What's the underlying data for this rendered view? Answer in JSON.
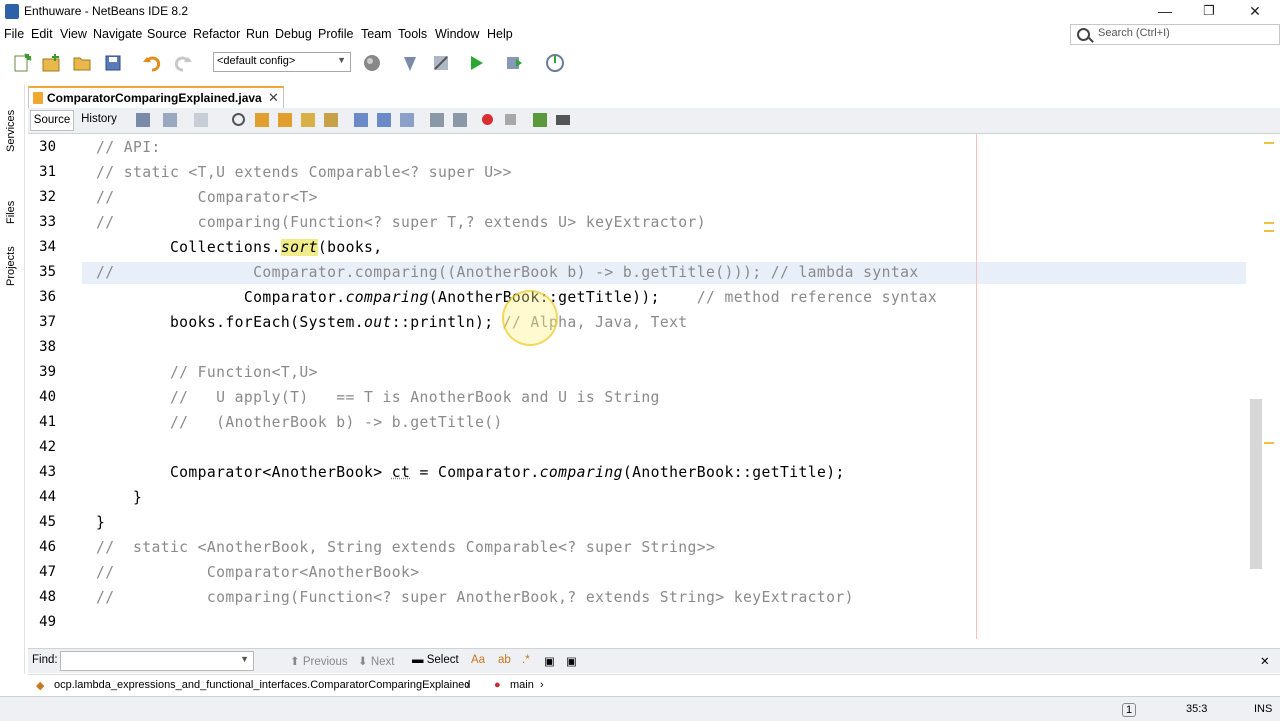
{
  "window": {
    "title": "Enthuware - NetBeans IDE 8.2",
    "minimize": "—",
    "maximize": "❐",
    "close": "✕"
  },
  "menu": [
    "File",
    "Edit",
    "View",
    "Navigate",
    "Source",
    "Refactor",
    "Run",
    "Debug",
    "Profile",
    "Team",
    "Tools",
    "Window",
    "Help"
  ],
  "search": {
    "placeholder": "Search (Ctrl+I)"
  },
  "toolbar": {
    "config": "<default config>"
  },
  "sidebar": {
    "items": [
      "Services",
      "Files",
      "Projects"
    ]
  },
  "editor_tab": {
    "label": "ComparatorComparingExplained.java",
    "close": "✕"
  },
  "editor_toolbar": {
    "source": "Source",
    "history": "History"
  },
  "code": {
    "lines": [
      {
        "n": "30",
        "text": "// API:",
        "indent": 0,
        "style": "cm"
      },
      {
        "n": "31",
        "text": "// static <T,U extends Comparable<? super U>>",
        "indent": 0,
        "style": "cm"
      },
      {
        "n": "32",
        "text": "//         Comparator<T>",
        "indent": 0,
        "style": "cm"
      },
      {
        "n": "33",
        "text": "//         comparing(Function<? super T,? extends U> keyExtractor)",
        "indent": 0,
        "style": "cm"
      },
      {
        "n": "34",
        "text": "",
        "indent": 0,
        "style": "code"
      },
      {
        "n": "35",
        "text": "//               Comparator.comparing((AnotherBook b) -> b.getTitle())); // lambda syntax",
        "indent": 0,
        "style": "cm"
      },
      {
        "n": "36",
        "text": "",
        "indent": 0,
        "style": "code"
      },
      {
        "n": "37",
        "text": "",
        "indent": 0,
        "style": "code"
      },
      {
        "n": "38",
        "text": "",
        "indent": 0,
        "style": "code"
      },
      {
        "n": "39",
        "text": "        // Function<T,U>",
        "indent": 0,
        "style": "cm"
      },
      {
        "n": "40",
        "text": "        //   U apply(T)   == T is AnotherBook and U is String",
        "indent": 0,
        "style": "cm"
      },
      {
        "n": "41",
        "text": "        //   (AnotherBook b) -> b.getTitle()",
        "indent": 0,
        "style": "cm"
      },
      {
        "n": "42",
        "text": "",
        "indent": 0,
        "style": "code"
      },
      {
        "n": "43",
        "text": "",
        "indent": 0,
        "style": "code"
      },
      {
        "n": "44",
        "text": "    }",
        "indent": 0,
        "style": "code"
      },
      {
        "n": "45",
        "text": "}",
        "indent": 0,
        "style": "code"
      },
      {
        "n": "46",
        "text": "//  static <AnotherBook, String extends Comparable<? super String>>",
        "indent": 0,
        "style": "cm"
      },
      {
        "n": "47",
        "text": "//          Comparator<AnotherBook>",
        "indent": 0,
        "style": "cm"
      },
      {
        "n": "48",
        "text": "//          comparing(Function<? super AnotherBook,? extends String> keyExtractor)",
        "indent": 0,
        "style": "cm"
      },
      {
        "n": "49",
        "text": "",
        "indent": 0,
        "style": "code"
      }
    ],
    "l34": {
      "a": "        Collections.",
      "b": "sort",
      "c": "(books,"
    },
    "l36": {
      "a": "                Comparator.",
      "b": "comparing",
      "c": "(AnotherBook::getTitle));",
      "d": "    // method reference syntax"
    },
    "l37": {
      "a": "        books.forEach(System.",
      "b": "out",
      "c": "::println);",
      "d": " // Alpha, Java, Text"
    },
    "l43": {
      "a": "        Comparator<AnotherBook> ",
      "b": "ct",
      "c": " = Comparator.",
      "d": "comparing",
      "e": "(AnotherBook::getTitle);"
    }
  },
  "findbar": {
    "label": "Find:",
    "previous": "Previous",
    "next": "Next",
    "select": "Select"
  },
  "navbar": {
    "class_path": "ocp.lambda_expressions_and_functional_interfaces.ComparatorComparingExplained",
    "method": "main"
  },
  "status": {
    "notifications": "1",
    "position": "35:3",
    "mode": "INS"
  }
}
